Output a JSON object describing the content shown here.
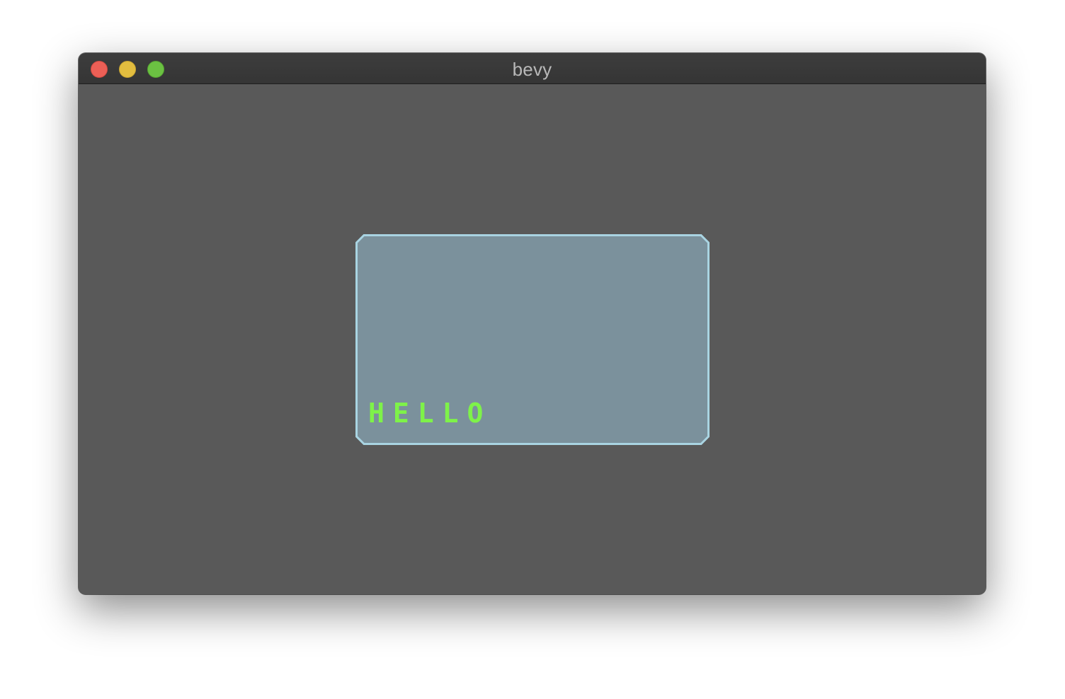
{
  "window": {
    "title": "bevy"
  },
  "panel": {
    "text": "HELLO",
    "colors": {
      "fill": "#7b919c",
      "border": "#a9d4e2",
      "text": "#7ef249"
    }
  },
  "colors": {
    "background": "#595959",
    "titlebar": "#3a3a3a",
    "close": "#ec5f56",
    "minimize": "#e2bd3f",
    "zoom": "#6bc142"
  }
}
